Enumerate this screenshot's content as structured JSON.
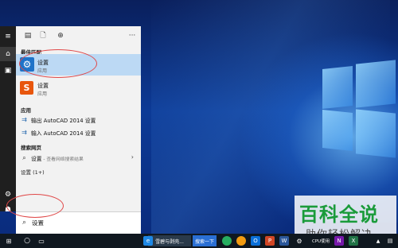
{
  "start_menu": {
    "tabs": [
      {
        "icon": "apps-icon",
        "glyph": "▤"
      },
      {
        "icon": "documents-icon",
        "glyph": "🗋"
      },
      {
        "icon": "web-icon",
        "glyph": "⊕"
      },
      {
        "icon": "more-icon",
        "glyph": "···"
      }
    ],
    "best_match_heading": "最佳匹配",
    "best_match": {
      "title": "设置",
      "subtitle": "应用",
      "icon": "settings-gear-icon",
      "glyph": "⚙"
    },
    "second_app": {
      "title": "设置",
      "subtitle": "应用",
      "icon": "sogou-input-icon",
      "glyph": "S"
    },
    "apps_heading": "应用",
    "apps": [
      {
        "icon": "autocad-output-settings-icon",
        "label": "输出 AutoCAD 2014 设置"
      },
      {
        "icon": "autocad-input-settings-icon",
        "label": "输入 AutoCAD 2014 设置"
      }
    ],
    "web_heading": "搜索网页",
    "web_result": {
      "icon": "search-icon",
      "label": "设置",
      "hint": " - 查看网络搜索结果"
    },
    "settings_count_label": "设置 (1+)",
    "rail": [
      {
        "name": "hamburger-menu-icon",
        "glyph": "≡"
      },
      {
        "name": "home-icon",
        "glyph": "⌂"
      },
      {
        "name": "notebook-icon",
        "glyph": "▣"
      },
      {
        "name": "settings-icon",
        "glyph": "⚙"
      },
      {
        "name": "feedback-icon",
        "glyph": "☗"
      }
    ]
  },
  "search": {
    "icon": "search-icon",
    "value": "设置"
  },
  "taskbar": {
    "start_glyph": "⊞",
    "search_glyph": "○",
    "taskview_glyph": "▭",
    "edge_task_label": "雪碧与剥壳...",
    "browser_task_label": "搜索一下",
    "cpu_label": "CPU使用",
    "apps": [
      {
        "name": "edge-icon",
        "glyph": "e",
        "color": "#1e88e5"
      },
      {
        "name": "green-app-icon",
        "glyph": "●",
        "color": "#27ae60"
      },
      {
        "name": "orange-app-icon",
        "glyph": "●",
        "color": "#f39c12"
      },
      {
        "name": "outlook-icon",
        "glyph": "O",
        "color": "#0a6fd8"
      },
      {
        "name": "powerpoint-icon",
        "glyph": "P",
        "color": "#d24726"
      },
      {
        "name": "word-icon",
        "glyph": "W",
        "color": "#2b579a"
      },
      {
        "name": "onenote-icon",
        "glyph": "N",
        "color": "#7719aa"
      },
      {
        "name": "excel-icon",
        "glyph": "X",
        "color": "#217346"
      },
      {
        "name": "gear-app-icon",
        "glyph": "⚙",
        "color": "#101820"
      },
      {
        "name": "tray-arrow-icon",
        "glyph": "▲",
        "color": "#101820"
      }
    ]
  },
  "watermark": {
    "main": "百科全说",
    "sub": "助你轻松解决"
  }
}
